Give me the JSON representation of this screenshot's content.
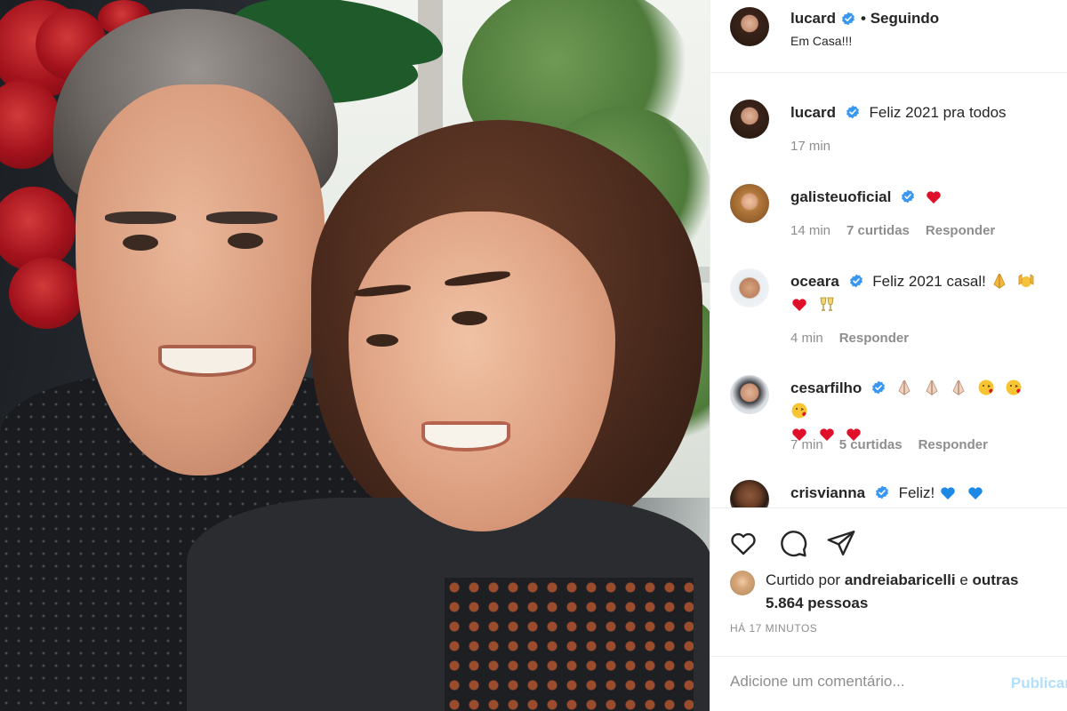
{
  "post": {
    "author": "lucard",
    "follow_status": "• Seguindo",
    "location": "Em Casa!!!"
  },
  "comments": [
    {
      "user": "lucard",
      "text": "Feliz 2021 pra todos",
      "time": "17 min",
      "likes": "",
      "reply": "",
      "emojis": []
    },
    {
      "user": "galisteuoficial",
      "text": "",
      "time": "14 min",
      "likes": "7 curtidas",
      "reply": "Responder",
      "emojis": [
        "red-heart"
      ]
    },
    {
      "user": "oceara",
      "text": "Feliz 2021 casal!",
      "time": "4 min",
      "likes": "",
      "reply": "Responder",
      "emojis": [
        "folded-hands",
        "raising-hands",
        "red-heart",
        "clinking-glasses"
      ]
    },
    {
      "user": "cesarfilho",
      "text": "",
      "time": "7 min",
      "likes": "5 curtidas",
      "reply": "Responder",
      "emojis": [
        "folded-hands",
        "folded-hands",
        "folded-hands",
        "kissing-face",
        "kissing-face",
        "kissing-face",
        "red-heart",
        "red-heart",
        "red-heart"
      ]
    },
    {
      "user": "crisvianna",
      "text": "Feliz!",
      "time": "",
      "likes": "",
      "reply": "",
      "emojis": [
        "blue-heart",
        "blue-heart"
      ]
    }
  ],
  "likes": {
    "prefix": "Curtido por",
    "user": "andreiabaricelli",
    "conj": "e",
    "others": "outras 5.864 pessoas"
  },
  "timestamp": "HÁ 17 MINUTOS",
  "add_comment": {
    "placeholder": "Adicione um comentário...",
    "publish_label": "Publicar"
  },
  "icons": {
    "like": "heart-outline-icon",
    "comment": "speech-bubble-icon",
    "share": "paper-plane-icon",
    "verified": "verified-badge-icon"
  },
  "colors": {
    "verified_blue": "#3897f0",
    "muted_text": "#8e8e8e",
    "divider": "#efefef",
    "publish_disabled": "#b2dffc"
  }
}
